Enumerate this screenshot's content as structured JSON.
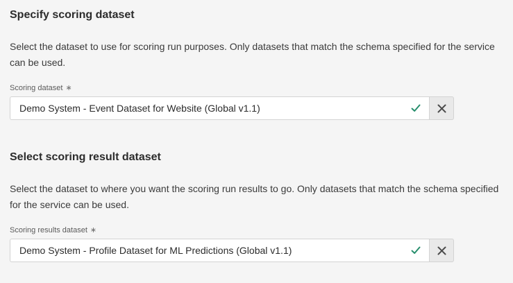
{
  "scoring_section": {
    "title": "Specify scoring dataset",
    "description": "Select the dataset to use for scoring run purposes. Only datasets that match the schema specified for the service can be used.",
    "field_label": "Scoring dataset",
    "required_marker": "∗",
    "field_value": "Demo System - Event Dataset for Website (Global v1.1)"
  },
  "result_section": {
    "title": "Select scoring result dataset",
    "description": "Select the dataset to where you want the scoring run results to go. Only datasets that match the schema specified for the service can be used.",
    "field_label": "Scoring results dataset",
    "required_marker": "∗",
    "field_value": "Demo System - Profile Dataset for ML Predictions (Global v1.1)"
  },
  "colors": {
    "valid_check": "#268e6c",
    "clear_icon": "#4b4b4b"
  },
  "icons": {
    "valid": "check-icon",
    "clear": "close-icon"
  }
}
